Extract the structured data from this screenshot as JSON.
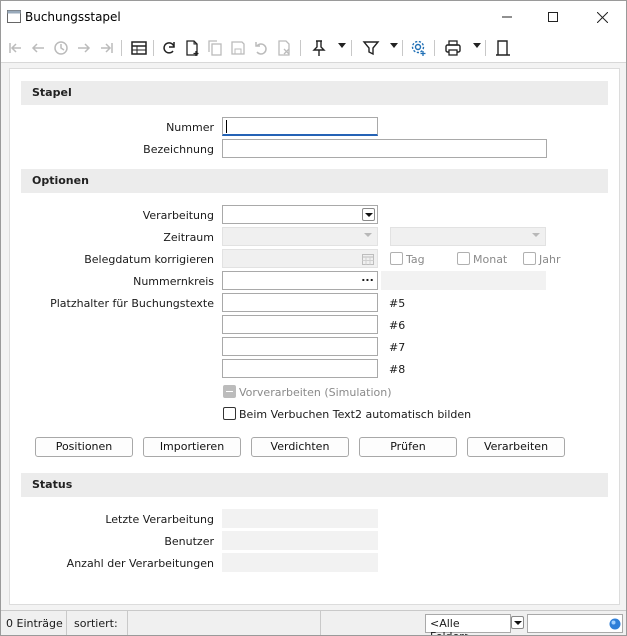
{
  "window": {
    "title": "Buchungsstapel"
  },
  "sections": {
    "stapel": "Stapel",
    "optionen": "Optionen",
    "status": "Status"
  },
  "stapel": {
    "nummer_label": "Nummer",
    "nummer_value": "",
    "bezeichnung_label": "Bezeichnung",
    "bezeichnung_value": ""
  },
  "optionen": {
    "verarbeitung_label": "Verarbeitung",
    "verarbeitung_value": "",
    "zeitraum_label": "Zeitraum",
    "belegdatum_label": "Belegdatum korrigieren",
    "tag_label": "Tag",
    "monat_label": "Monat",
    "jahr_label": "Jahr",
    "nummernkreis_label": "Nummernkreis",
    "nummernkreis_button": "...",
    "platzhalter_label": "Platzhalter für Buchungstexte",
    "placeholders": [
      "#5",
      "#6",
      "#7",
      "#8"
    ],
    "vorverarbeiten_label": "Vorverarbeiten (Simulation)",
    "text2_label": "Beim Verbuchen Text2 automatisch bilden"
  },
  "buttons": {
    "positionen": "Positionen",
    "importieren": "Importieren",
    "verdichten": "Verdichten",
    "pruefen": "Prüfen",
    "verarbeiten": "Verarbeiten"
  },
  "status": {
    "letzte_label": "Letzte Verarbeitung",
    "benutzer_label": "Benutzer",
    "anzahl_label": "Anzahl der Verarbeitungen"
  },
  "statusbar": {
    "entries": "0 Einträge",
    "sorted": "sortiert:",
    "field_select": "<Alle Felder>"
  }
}
